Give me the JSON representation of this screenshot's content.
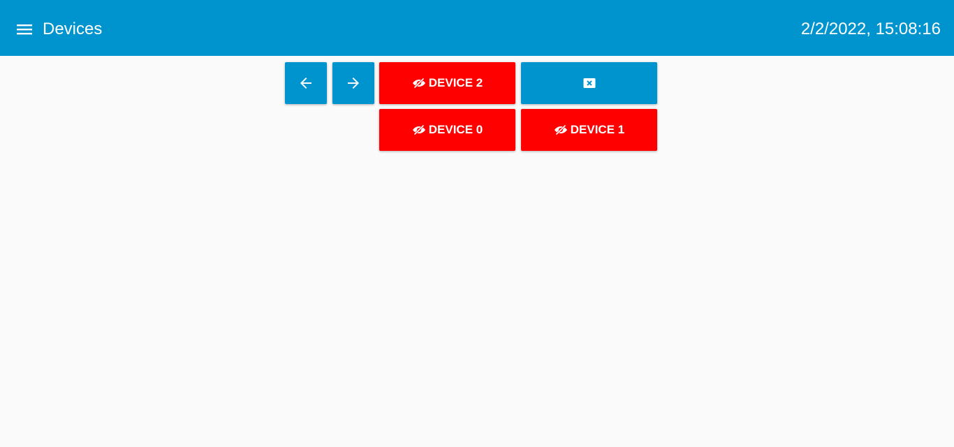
{
  "header": {
    "title": "Devices",
    "clock": "2/2/2022, 15:08:16",
    "menu_icon": "hamburger-menu-icon"
  },
  "toolbar": {
    "back_icon": "arrow-left-icon",
    "forward_icon": "arrow-right-icon",
    "clear_icon": "backspace-icon"
  },
  "devices": [
    {
      "label": "DEVICE 2",
      "icon": "eye-slash-icon"
    },
    {
      "label": "DEVICE 0",
      "icon": "eye-slash-icon"
    },
    {
      "label": "DEVICE 1",
      "icon": "eye-slash-icon"
    }
  ],
  "colors": {
    "primary": "#0094ce",
    "device_off": "#ff0000",
    "background": "#fafafa",
    "text_on_primary": "#ffffff"
  }
}
